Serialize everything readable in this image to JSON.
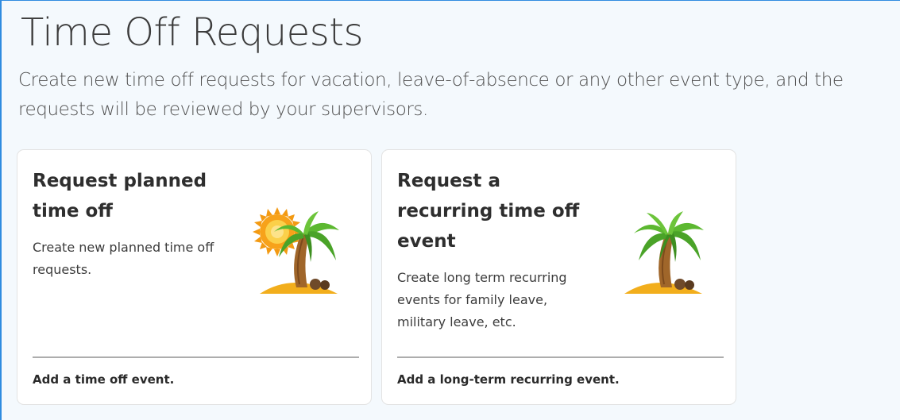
{
  "page": {
    "title": "Time Off Requests",
    "description": "Create new time off requests for vacation, leave-of-absence or any other event type, and the requests will be reviewed by your supervisors."
  },
  "cards": [
    {
      "title": "Request planned time off",
      "description": "Create new planned time off requests.",
      "action": "Add a time off event.",
      "icon": "palm-tree-with-sun-icon"
    },
    {
      "title": "Request a recurring time off event",
      "description": "Create long term recurring events for family leave, military leave, etc.",
      "action": "Add a long-term recurring event.",
      "icon": "palm-tree-icon"
    }
  ],
  "colors": {
    "accent_border": "#2f8ce0",
    "page_background": "#f4f9fd",
    "card_background": "#ffffff",
    "palm_leaf": "#5cb830",
    "palm_trunk": "#a0662a",
    "sand": "#f2ae1c",
    "sun": "#f7a21a"
  }
}
